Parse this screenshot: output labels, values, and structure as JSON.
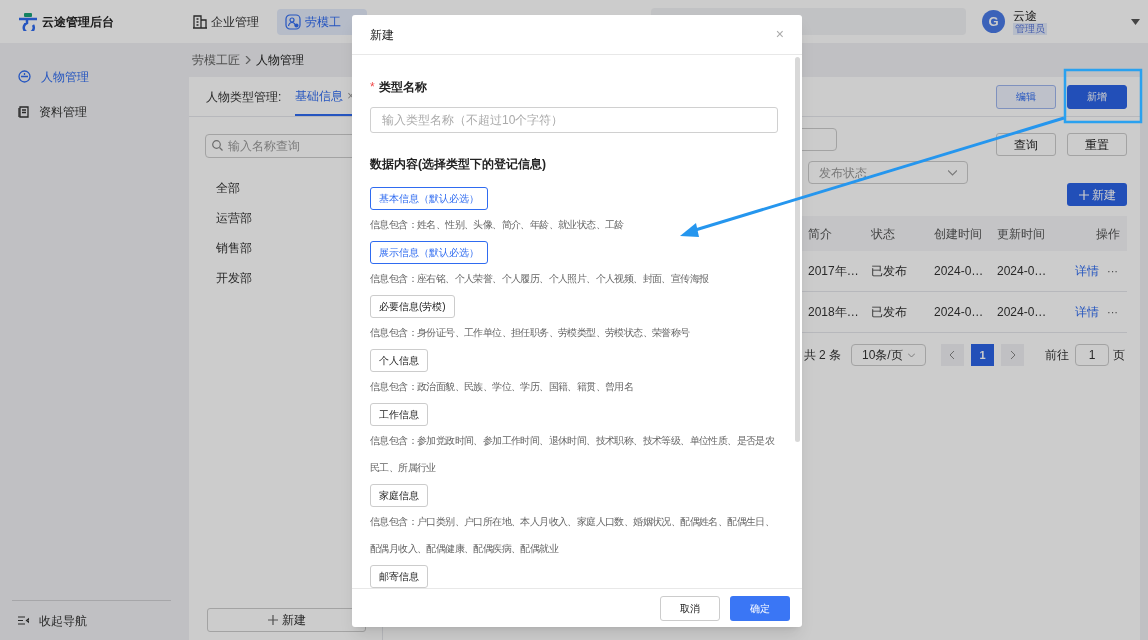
{
  "app": {
    "logo_text": "云途管理后台"
  },
  "top_nav": [
    {
      "label": "企业管理",
      "selected": false,
      "kind": "building"
    },
    {
      "label": "劳模工",
      "selected": true,
      "kind": "worker"
    }
  ],
  "user": {
    "avatar": "G",
    "name": "云途",
    "role": "管理员"
  },
  "sidebar": {
    "items": [
      {
        "label": "人物管理",
        "selected": true,
        "kind": "person"
      },
      {
        "label": "资料管理",
        "selected": false,
        "kind": "book"
      }
    ],
    "collapse": "收起导航"
  },
  "breadcrumb": [
    "劳模工匠",
    "人物管理"
  ],
  "type_tabs": {
    "label": "人物类型管理:",
    "tabs": [
      {
        "label": "基础信息",
        "selected": true,
        "close": "×"
      }
    ]
  },
  "header_buttons": [
    {
      "label": "编辑",
      "kind": "secondary"
    },
    {
      "label": "新增",
      "kind": "primary"
    }
  ],
  "department_panel": {
    "search_placeholder": "输入名称查询",
    "items": [
      "全部",
      "运营部",
      "销售部",
      "开发部"
    ],
    "add_button": "新建"
  },
  "filters": {
    "status_placeholder": "发布状态",
    "query_button": "查询",
    "reset_button": "重置",
    "new_button": "新建"
  },
  "table": {
    "columns": [
      "简介",
      "状态",
      "创建时间",
      "更新时间",
      "操作"
    ],
    "rows": [
      {
        "cells": [
          "2017年…",
          "已发布",
          "2024-0…",
          "2024-0…"
        ],
        "action": "详情",
        "more": "···"
      },
      {
        "cells": [
          "2018年…",
          "已发布",
          "2024-0…",
          "2024-0…"
        ],
        "action": "详情",
        "more": "···"
      }
    ]
  },
  "pagination": {
    "total": "共 2 条",
    "page_size": "10条/页",
    "pages": [
      {
        "label": "1",
        "selected": true
      }
    ],
    "goto_label": "前往",
    "goto_value": "1",
    "page_unit": "页"
  },
  "dialog": {
    "title": "新建",
    "close": "×",
    "required_mark": "*",
    "name_label": "类型名称",
    "name_placeholder": "输入类型名称（不超过10个字符）",
    "section_title": "数据内容(选择类型下的登记信息)",
    "groups": [
      {
        "label": "基本信息（默认必选）",
        "selected": true,
        "description": "信息包含：姓名、性别、头像、简介、年龄、就业状态、工龄"
      },
      {
        "label": "展示信息（默认必选）",
        "selected": true,
        "description": "信息包含：座右铭、个人荣誉、个人履历、个人照片、个人视频、封面、宣传海报"
      },
      {
        "label": "必要信息(劳模)",
        "selected": false,
        "description": "信息包含：身份证号、工作单位、担任职务、劳模类型、劳模状态、荣誉称号"
      },
      {
        "label": "个人信息",
        "selected": false,
        "description": "信息包含：政治面貌、民族、学位、学历、国籍、籍贯、曾用名"
      },
      {
        "label": "工作信息",
        "selected": false,
        "description": "信息包含：参加党政时间、参加工作时间、退休时间、技术职称、技术等级、单位性质、是否是农民工、所属行业"
      },
      {
        "label": "家庭信息",
        "selected": false,
        "description": "信息包含：户口类别、户口所在地、本人月收入、家庭人口数、婚姻状况、配偶姓名、配偶生日、配偶月收入、配偶健康、配偶疾病、配偶就业"
      },
      {
        "label": "邮寄信息",
        "selected": false
      }
    ],
    "cancel": "取消",
    "confirm": "确定"
  }
}
